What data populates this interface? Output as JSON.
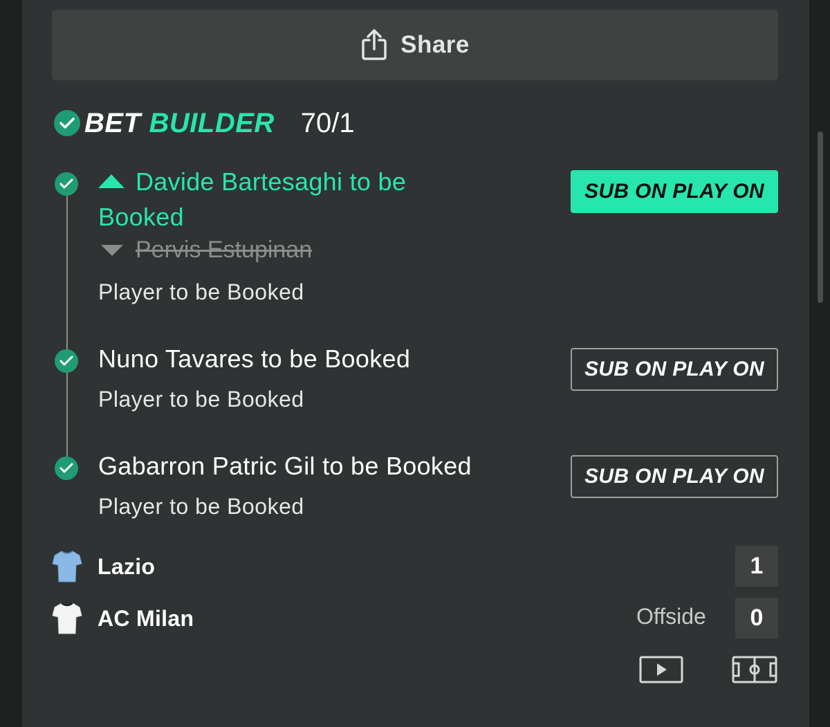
{
  "share": {
    "label": "Share"
  },
  "bet_builder": {
    "word1": "BET",
    "word2": "BUILDER",
    "odds": "70/1"
  },
  "legs": [
    {
      "title": "Davide Bartesaghi to be Booked",
      "replaced": "Pervis Estupinan",
      "market": "Player to be Booked",
      "button": "SUB ON PLAY ON",
      "button_active": true
    },
    {
      "title": "Nuno Tavares to be Booked",
      "market": "Player to be Booked",
      "button": "SUB ON PLAY ON",
      "button_active": false
    },
    {
      "title": "Gabarron Patric Gil to be Booked",
      "market": "Player to be Booked",
      "button": "SUB ON PLAY ON",
      "button_active": false
    }
  ],
  "match": {
    "home": {
      "name": "Lazio",
      "score": "1",
      "shirt": "light-blue-shirt-icon"
    },
    "away": {
      "name": "AC Milan",
      "score": "0",
      "shirt": "white-shirt-icon"
    },
    "event": "Offside"
  },
  "icons": {
    "share": "share-icon",
    "video": "play-video-icon",
    "pitch": "pitch-icon"
  },
  "colors": {
    "accent": "#27e6ad",
    "check": "#1f9c74",
    "panel": "#303333",
    "background": "#1f2121"
  }
}
